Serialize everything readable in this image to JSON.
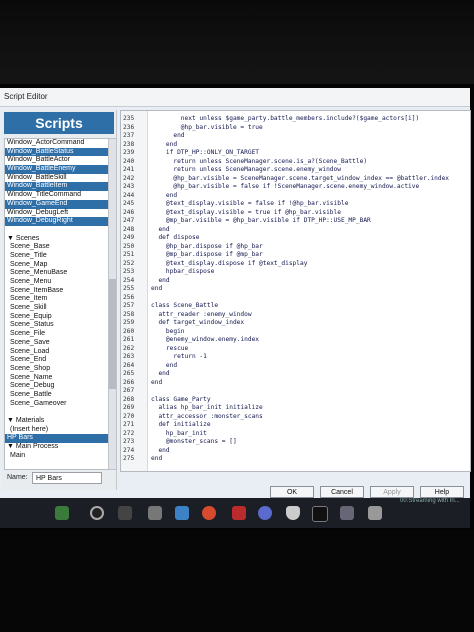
{
  "window": {
    "title": "Script Editor"
  },
  "left": {
    "header": "Scripts",
    "items": [
      {
        "label": "Window_ActorCommand",
        "state": "normal"
      },
      {
        "label": "Window_BattleStatus",
        "state": "sel"
      },
      {
        "label": "Window_BattleActor",
        "state": "normal"
      },
      {
        "label": "Window_BattleEnemy",
        "state": "sel"
      },
      {
        "label": "Window_BattleSkill",
        "state": "normal"
      },
      {
        "label": "Window_BattleItem",
        "state": "sel"
      },
      {
        "label": "Window_TitleCommand",
        "state": "normal"
      },
      {
        "label": "Window_GameEnd",
        "state": "sel"
      },
      {
        "label": "Window_DebugLeft",
        "state": "normal"
      },
      {
        "label": "Window_DebugRight",
        "state": "sel"
      },
      {
        "label": "",
        "state": "normal"
      },
      {
        "label": "▼ Scenes",
        "state": "hdr"
      },
      {
        "label": "Scene_Base",
        "state": "ind"
      },
      {
        "label": "Scene_Title",
        "state": "ind"
      },
      {
        "label": "Scene_Map",
        "state": "ind"
      },
      {
        "label": "Scene_MenuBase",
        "state": "ind"
      },
      {
        "label": "Scene_Menu",
        "state": "ind"
      },
      {
        "label": "Scene_ItemBase",
        "state": "ind"
      },
      {
        "label": "Scene_Item",
        "state": "ind"
      },
      {
        "label": "Scene_Skill",
        "state": "ind"
      },
      {
        "label": "Scene_Equip",
        "state": "ind"
      },
      {
        "label": "Scene_Status",
        "state": "ind"
      },
      {
        "label": "Scene_File",
        "state": "ind"
      },
      {
        "label": "Scene_Save",
        "state": "ind"
      },
      {
        "label": "Scene_Load",
        "state": "ind"
      },
      {
        "label": "Scene_End",
        "state": "ind"
      },
      {
        "label": "Scene_Shop",
        "state": "ind"
      },
      {
        "label": "Scene_Name",
        "state": "ind"
      },
      {
        "label": "Scene_Debug",
        "state": "ind"
      },
      {
        "label": "Scene_Battle",
        "state": "ind"
      },
      {
        "label": "Scene_Gameover",
        "state": "ind"
      },
      {
        "label": "",
        "state": "normal"
      },
      {
        "label": "▼ Materials",
        "state": "hdr"
      },
      {
        "label": "(Insert here)",
        "state": "ind"
      },
      {
        "label": "HP Bars",
        "state": "sel"
      },
      {
        "label": "▼ Main Process",
        "state": "hdr"
      },
      {
        "label": "Main",
        "state": "ind"
      }
    ],
    "name_label": "Name:",
    "name_value": "HP Bars"
  },
  "editor": {
    "lines": [
      {
        "n": "235",
        "t": "        next unless $game_party.battle_members.include?($game_actors[i])"
      },
      {
        "n": "236",
        "t": "        @hp_bar.visible = true"
      },
      {
        "n": "237",
        "t": "      end"
      },
      {
        "n": "238",
        "t": "    end"
      },
      {
        "n": "239",
        "t": "    if DTP_HP::ONLY_ON_TARGET"
      },
      {
        "n": "240",
        "t": "      return unless SceneManager.scene.is_a?(Scene_Battle)"
      },
      {
        "n": "241",
        "t": "      return unless SceneManager.scene.enemy_window"
      },
      {
        "n": "242",
        "t": "      @hp_bar.visible = SceneManager.scene.target_window_index == @battler.index"
      },
      {
        "n": "243",
        "t": "      @hp_bar.visible = false if !SceneManager.scene.enemy_window.active"
      },
      {
        "n": "244",
        "t": "    end"
      },
      {
        "n": "245",
        "t": "    @text_display.visible = false if !@hp_bar.visible"
      },
      {
        "n": "246",
        "t": "    @text_display.visible = true if @hp_bar.visible"
      },
      {
        "n": "247",
        "t": "    @mp_bar.visible = @hp_bar.visible if DTP_HP::USE_MP_BAR"
      },
      {
        "n": "248",
        "t": "  end"
      },
      {
        "n": "249",
        "t": "  def dispose"
      },
      {
        "n": "250",
        "t": "    @hp_bar.dispose if @hp_bar"
      },
      {
        "n": "251",
        "t": "    @mp_bar.dispose if @mp_bar"
      },
      {
        "n": "252",
        "t": "    @text_display.dispose if @text_display"
      },
      {
        "n": "253",
        "t": "    hpbar_dispose"
      },
      {
        "n": "254",
        "t": "  end"
      },
      {
        "n": "255",
        "t": "end"
      },
      {
        "n": "256",
        "t": ""
      },
      {
        "n": "257",
        "t": "class Scene_Battle"
      },
      {
        "n": "258",
        "t": "  attr_reader :enemy_window"
      },
      {
        "n": "259",
        "t": "  def target_window_index"
      },
      {
        "n": "260",
        "t": "    begin"
      },
      {
        "n": "261",
        "t": "    @enemy_window.enemy.index"
      },
      {
        "n": "262",
        "t": "    rescue"
      },
      {
        "n": "263",
        "t": "      return -1"
      },
      {
        "n": "264",
        "t": "    end"
      },
      {
        "n": "265",
        "t": "  end"
      },
      {
        "n": "266",
        "t": "end"
      },
      {
        "n": "267",
        "t": ""
      },
      {
        "n": "268",
        "t": "class Game_Party"
      },
      {
        "n": "269",
        "t": "  alias hp_bar_init initialize"
      },
      {
        "n": "270",
        "t": "  attr_accessor :monster_scans"
      },
      {
        "n": "271",
        "t": "  def initialize"
      },
      {
        "n": "272",
        "t": "    hp_bar_init"
      },
      {
        "n": "273",
        "t": "    @monster_scans = []"
      },
      {
        "n": "274",
        "t": "  end"
      },
      {
        "n": "275",
        "t": "end"
      }
    ]
  },
  "buttons": {
    "ok": "OK",
    "cancel": "Cancel",
    "apply": "Apply",
    "help": "Help"
  },
  "taskbar": {
    "notice": "00:Streaming with In..."
  }
}
